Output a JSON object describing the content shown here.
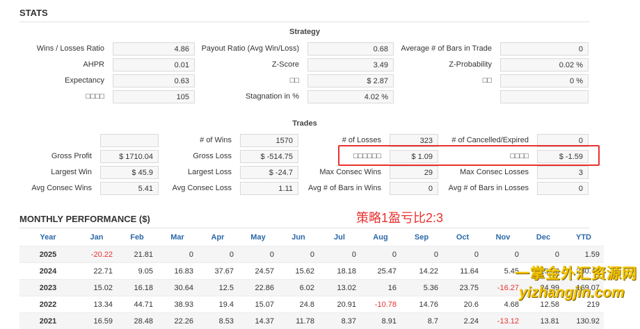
{
  "stats": {
    "title": "STATS",
    "strategy": {
      "heading": "Strategy",
      "rows": [
        [
          {
            "label": "Wins / Losses Ratio",
            "value": "4.86"
          },
          {
            "label": "Payout Ratio (Avg Win/Loss)",
            "value": "0.68"
          },
          {
            "label": "Average # of Bars in Trade",
            "value": "0"
          }
        ],
        [
          {
            "label": "AHPR",
            "value": "0.01"
          },
          {
            "label": "Z-Score",
            "value": "3.49"
          },
          {
            "label": "Z-Probability",
            "value": "0.02 %"
          }
        ],
        [
          {
            "label": "Expectancy",
            "value": "0.63"
          },
          {
            "label": "□□",
            "value": "$ 2.87"
          },
          {
            "label": "□□",
            "value": "0 %"
          }
        ],
        [
          {
            "label": "□□□□",
            "value": "105"
          },
          {
            "label": "Stagnation in %",
            "value": "4.02 %"
          },
          {
            "label": "",
            "value": ""
          }
        ]
      ]
    },
    "trades": {
      "heading": "Trades",
      "rows": [
        [
          {
            "label": "",
            "value": ""
          },
          {
            "label": "# of Wins",
            "value": "1570"
          },
          {
            "label": "# of Losses",
            "value": "323"
          },
          {
            "label": "# of Cancelled/Expired",
            "value": "0"
          }
        ],
        [
          {
            "label": "Gross Profit",
            "value": "$ 1710.04"
          },
          {
            "label": "Gross Loss",
            "value": "$ -514.75"
          },
          {
            "label": "□□□□□□",
            "value": "$ 1.09"
          },
          {
            "label": "□□□□",
            "value": "$ -1.59"
          }
        ],
        [
          {
            "label": "Largest Win",
            "value": "$ 45.9"
          },
          {
            "label": "Largest Loss",
            "value": "$ -24.7"
          },
          {
            "label": "Max Consec Wins",
            "value": "29"
          },
          {
            "label": "Max Consec Losses",
            "value": "3"
          }
        ],
        [
          {
            "label": "Avg Consec Wins",
            "value": "5.41"
          },
          {
            "label": "Avg Consec Loss",
            "value": "1.11"
          },
          {
            "label": "Avg # of Bars in Wins",
            "value": "0"
          },
          {
            "label": "Avg # of Bars in Losses",
            "value": "0"
          }
        ]
      ]
    }
  },
  "annotation": {
    "text": "策略1盈亏比2:3",
    "color": "#e8302d"
  },
  "monthly": {
    "title": "MONTHLY PERFORMANCE ($)",
    "columns": [
      "Year",
      "Jan",
      "Feb",
      "Mar",
      "Apr",
      "May",
      "Jun",
      "Jul",
      "Aug",
      "Sep",
      "Oct",
      "Nov",
      "Dec",
      "YTD"
    ],
    "rows": [
      {
        "year": "2025",
        "values": [
          "-20.22",
          "21.81",
          "0",
          "0",
          "0",
          "0",
          "0",
          "0",
          "0",
          "0",
          "0",
          "0",
          "1.59"
        ]
      },
      {
        "year": "2024",
        "values": [
          "22.71",
          "9.05",
          "16.83",
          "37.67",
          "24.57",
          "15.62",
          "18.18",
          "25.47",
          "14.22",
          "11.64",
          "5.45",
          "29.00",
          "230.41"
        ]
      },
      {
        "year": "2023",
        "values": [
          "15.02",
          "16.18",
          "30.64",
          "12.5",
          "22.86",
          "6.02",
          "13.02",
          "16",
          "5.36",
          "23.75",
          "-16.27",
          "24.99",
          "169.07"
        ]
      },
      {
        "year": "2022",
        "values": [
          "13.34",
          "44.71",
          "38.93",
          "19.4",
          "15.07",
          "24.8",
          "20.91",
          "-10.78",
          "14.76",
          "20.6",
          "4.68",
          "12.58",
          "219"
        ]
      },
      {
        "year": "2021",
        "values": [
          "16.59",
          "28.48",
          "22.26",
          "8.53",
          "14.37",
          "11.78",
          "8.37",
          "8.91",
          "8.7",
          "2.24",
          "-13.12",
          "13.81",
          "130.92"
        ]
      }
    ]
  },
  "watermark": {
    "line1": "一掌金外汇资源网",
    "line2": "yizhangjin.com"
  },
  "colors": {
    "accent_blue": "#2b68a8",
    "negative_red": "#e8302d",
    "watermark_yellow": "#f3c400"
  }
}
